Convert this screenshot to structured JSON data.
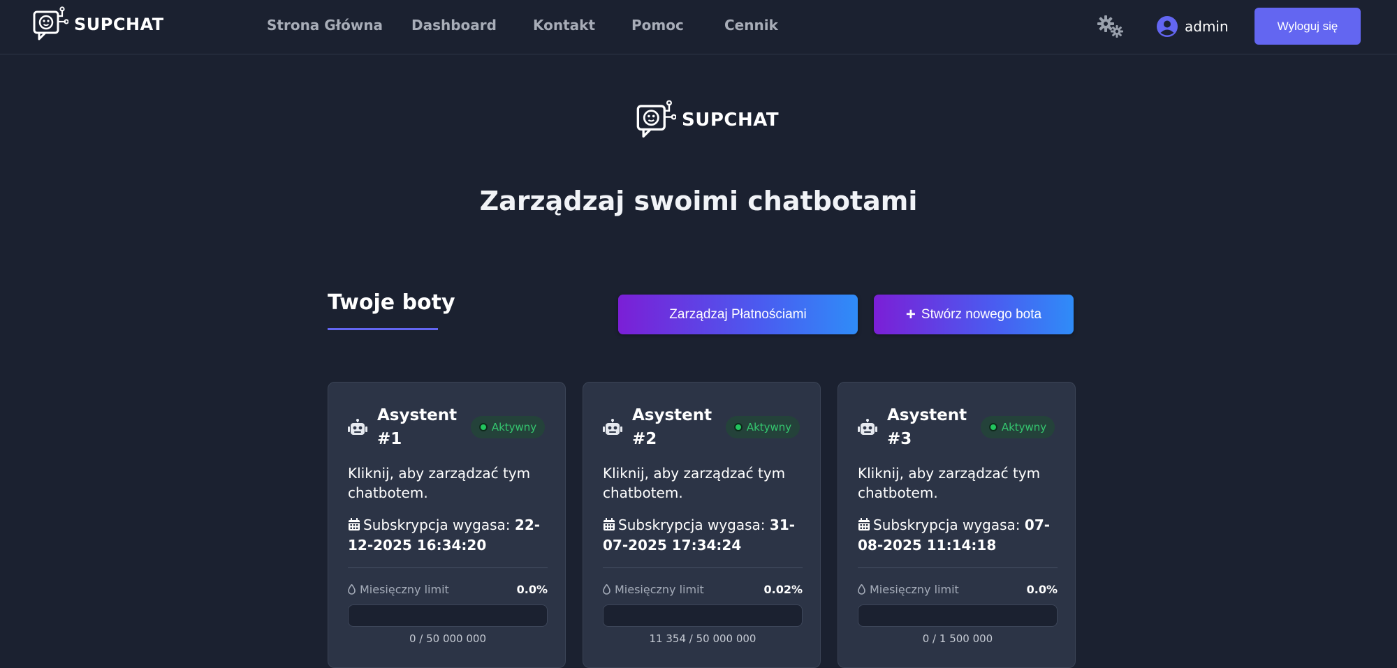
{
  "navbar": {
    "brand": "SUPCHAT",
    "links": [
      {
        "label": "Strona Główna"
      },
      {
        "label": "Dashboard"
      },
      {
        "label": "Kontakt"
      },
      {
        "label": "Pomoc"
      },
      {
        "label": "Cennik"
      }
    ],
    "settings_icon": "gears-icon",
    "user_icon": "user-circle-icon",
    "username": "admin",
    "logout_label": "Wyloguj się"
  },
  "hero": {
    "brand": "SUPCHAT",
    "headline": "Zarządzaj swoimi chatbotami"
  },
  "section": {
    "title": "Twoje boty",
    "payments_button": "Zarządzaj Płatnościami",
    "new_bot_plus": "+",
    "new_bot_button": "Stwórz nowego bota"
  },
  "bots": [
    {
      "name": "Asystent #1",
      "status": "Aktywny",
      "description": "Kliknij, aby zarządzać tym chatbotem.",
      "expiry_label": "Subskrypcja wygasa:",
      "expiry_value": "22-12-2025 16:34:20",
      "limit_label": "Miesięczny limit",
      "limit_pct": "0.0%",
      "usage_fraction": 0.0,
      "usage_text": "0 / 50 000 000"
    },
    {
      "name": "Asystent #2",
      "status": "Aktywny",
      "description": "Kliknij, aby zarządzać tym chatbotem.",
      "expiry_label": "Subskrypcja wygasa:",
      "expiry_value": "31-07-2025 17:34:24",
      "limit_label": "Miesięczny limit",
      "limit_pct": "0.02%",
      "usage_fraction": 0.0002,
      "usage_text": "11 354 / 50 000 000"
    },
    {
      "name": "Asystent #3",
      "status": "Aktywny",
      "description": "Kliknij, aby zarządzać tym chatbotem.",
      "expiry_label": "Subskrypcja wygasa:",
      "expiry_value": "07-08-2025 11:14:18",
      "limit_label": "Miesięczny limit",
      "limit_pct": "0.0%",
      "usage_fraction": 0.0,
      "usage_text": "0 / 1 500 000"
    }
  ],
  "colors": {
    "background": "#1b2130",
    "card": "#2c3446",
    "accent": "#6366f1",
    "status_green": "#22c55e"
  }
}
